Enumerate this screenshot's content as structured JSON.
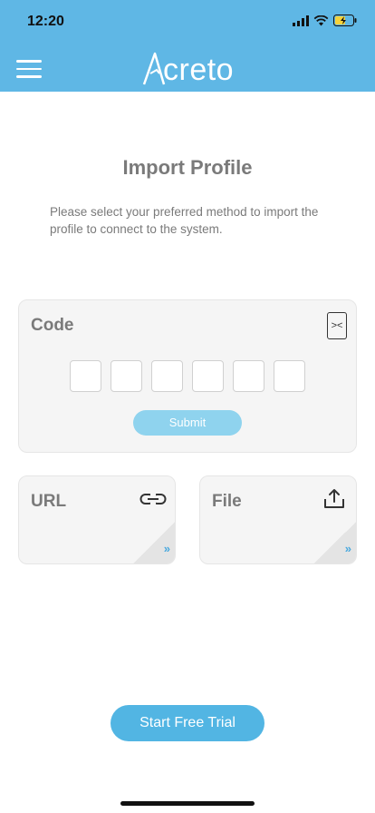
{
  "status_bar": {
    "time": "12:20"
  },
  "header": {
    "logo_text": "creto",
    "logo_mark": "A"
  },
  "page": {
    "title": "Import Profile",
    "subtitle": "Please select your preferred method to import the profile to connect to the system."
  },
  "code_card": {
    "title": "Code",
    "scan_glyph": "><",
    "submit_label": "Submit",
    "digits": [
      "",
      "",
      "",
      "",
      "",
      ""
    ]
  },
  "url_card": {
    "title": "URL",
    "icon": "link-icon",
    "chevron": "»"
  },
  "file_card": {
    "title": "File",
    "icon": "upload-icon",
    "chevron": "»"
  },
  "cta": {
    "label": "Start Free Trial"
  },
  "colors": {
    "header": "#5fb7e5",
    "accent": "#52b5e3",
    "submit": "#8fd3ee"
  }
}
